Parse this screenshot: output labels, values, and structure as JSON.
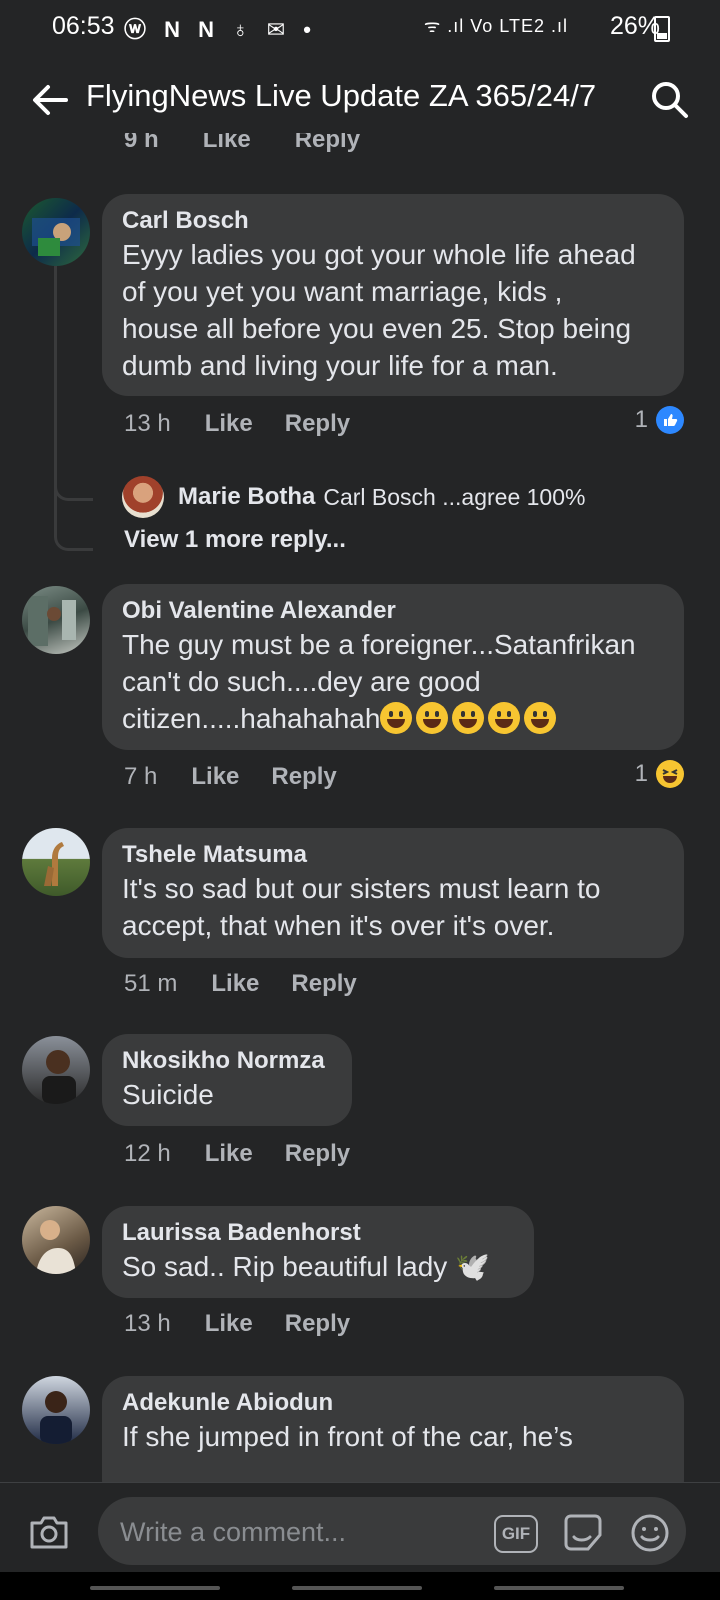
{
  "status": {
    "time": "06:53",
    "left_icons": "ⓦ N N ♁ ✉ •",
    "right": "26%",
    "signal": "ᯤ .ıl Vo LTE2 .ıl"
  },
  "header": {
    "title": "FlyingNews Live Update ZA 365/24/7"
  },
  "prev_actions": {
    "time": "9 h",
    "like": "Like",
    "reply": "Reply"
  },
  "comments": [
    {
      "name": "Carl Bosch",
      "lines": [
        "Eyyy ladies you got your whole life ahead",
        "of you yet you want marriage, kids ,",
        "house all before you even 25.  Stop being",
        "dumb and  living your life for a man."
      ],
      "time": "13 h",
      "like": "Like",
      "reply": "Reply",
      "react_count": "1",
      "react": "like"
    },
    {
      "name": "Obi Valentine Alexander",
      "lines": [
        "The guy must be a foreigner...Satanfrikan",
        "can't do such....dey are good",
        "citizen.....hahahahah"
      ],
      "time": "7 h",
      "like": "Like",
      "reply": "Reply",
      "react_count": "1",
      "react": "haha"
    },
    {
      "name": "Tshele Matsuma",
      "lines": [
        "It's so sad but our sisters must learn to",
        "accept, that when it's over it's over."
      ],
      "time": "51 m",
      "like": "Like",
      "reply": "Reply"
    },
    {
      "name": "Nkosikho Normza",
      "lines": [
        "Suicide"
      ],
      "time": "12 h",
      "like": "Like",
      "reply": "Reply"
    },
    {
      "name": "Laurissa Badenhorst",
      "lines": [
        "So sad.. Rip beautiful lady 🕊️"
      ],
      "time": "13 h",
      "like": "Like",
      "reply": "Reply"
    },
    {
      "name": "Adekunle Abiodun",
      "lines": [
        "If she jumped in front of the car, he’s"
      ]
    }
  ],
  "reply": {
    "name": "Marie Botha",
    "text": "Carl Bosch ...agree 100%"
  },
  "view_more": "View 1 more reply...",
  "composer": {
    "placeholder": "Write a comment...",
    "gif": "GIF"
  }
}
